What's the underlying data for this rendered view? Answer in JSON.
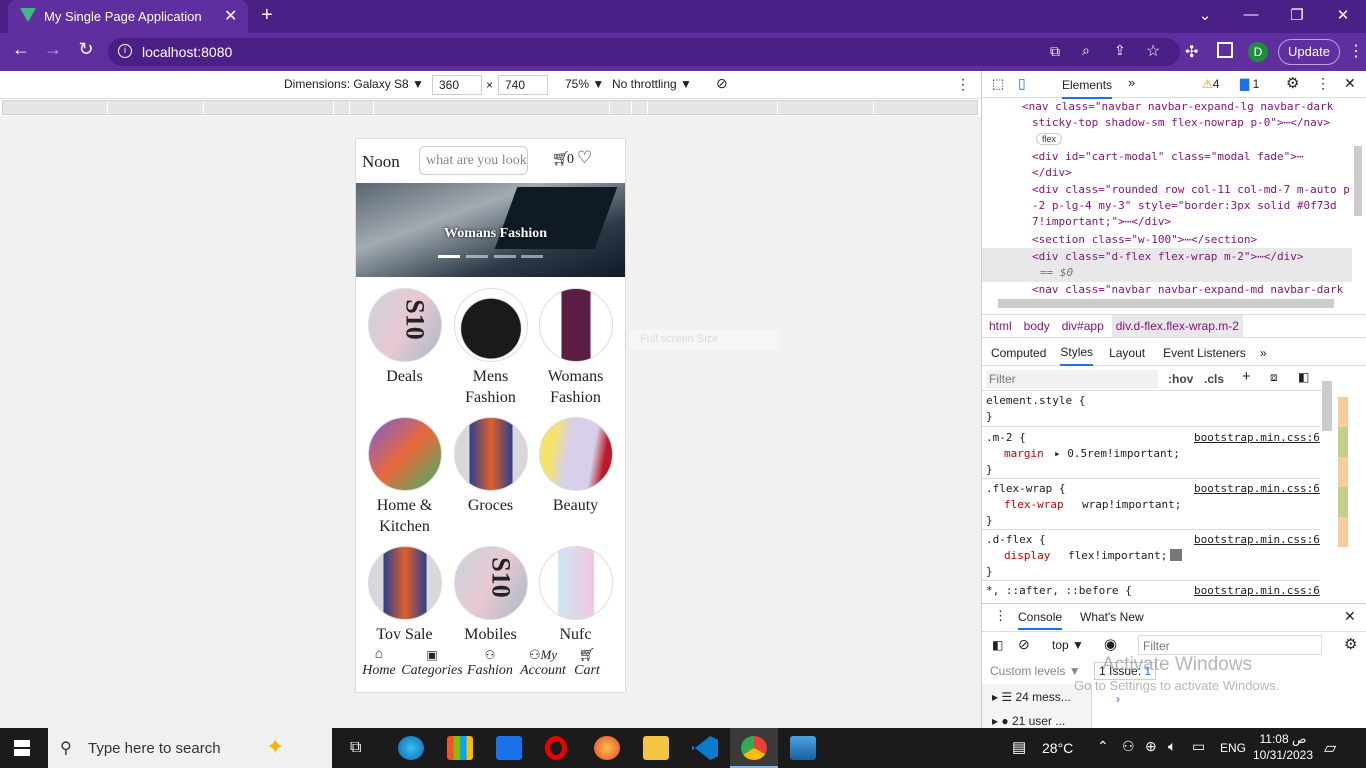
{
  "browser": {
    "tab_title": "My Single Page Application",
    "url": "localhost:8080",
    "update_label": "Update",
    "profile_initial": "D"
  },
  "device_toolbar": {
    "dimensions_label": "Dimensions: Galaxy S8",
    "width": "360",
    "height": "740",
    "zoom": "75%",
    "throttling": "No throttling",
    "ghost_text": "Full screen Size"
  },
  "app": {
    "brand": "Noon",
    "search_placeholder": "what are you looking for",
    "cart_count": "0",
    "banner_caption": "Womans Fashion",
    "categories": [
      {
        "line1": "Deals",
        "line2": ""
      },
      {
        "line1": "Mens",
        "line2": "Fashion"
      },
      {
        "line1": "Womans",
        "line2": "Fashion"
      },
      {
        "line1": "Home &",
        "line2": "Kitchen"
      },
      {
        "line1": "Groces",
        "line2": ""
      },
      {
        "line1": "Beauty",
        "line2": ""
      },
      {
        "line1": "Toy Sale",
        "line2": ""
      },
      {
        "line1": "Mobiles",
        "line2": ""
      },
      {
        "line1": "Nufc",
        "line2": ""
      }
    ],
    "bottom_nav": [
      "Home",
      "Categories",
      "Fashion",
      "Account",
      "Cart"
    ],
    "bottom_nav_my": "My"
  },
  "devtools": {
    "tab_elements": "Elements",
    "warnings": "4",
    "messages": "1",
    "dom_lines": [
      "<nav class=\"navbar navbar-expand-lg navbar-dark",
      "sticky-top shadow-sm flex-nowrap p-0\">⋯</nav>",
      "flex",
      "<div id=\"cart-modal\" class=\"modal fade\">⋯",
      "</div>",
      "<div class=\"rounded row col-11 col-md-7 m-auto p",
      "-2 p-lg-4 my-3\" style=\"border:3px  solid #0f73d",
      "7!important;\">⋯</div>",
      "<section class=\"w-100\">⋯</section>",
      "<div class=\"d-flex flex-wrap m-2\">⋯</div>",
      "== $0",
      "<nav class=\"navbar navbar-expand-md navbar-dark"
    ],
    "breadcrumb": [
      "html",
      "body",
      "div#app",
      "div.d-flex.flex-wrap.m-2"
    ],
    "subtabs": [
      "Computed",
      "Styles",
      "Layout",
      "Event Listeners"
    ],
    "filter_placeholder": "Filter",
    "hov": ":hov",
    "cls": ".cls",
    "rules": [
      {
        "selector": "element.style {",
        "prop": "",
        "value": "",
        "source": ""
      },
      {
        "selector": ".m-2 {",
        "prop": "margin",
        "value": "▸ 0.5rem!important;",
        "source": "bootstrap.min.css:6"
      },
      {
        "selector": ".flex-wrap {",
        "prop": "flex-wrap",
        "value": "wrap!important;",
        "source": "bootstrap.min.css:6"
      },
      {
        "selector": ".d-flex {",
        "prop": "display",
        "value": "flex!important;",
        "source": "bootstrap.min.css:6"
      },
      {
        "selector": "*, ::after, ::before {",
        "prop": "",
        "value": "",
        "source": "bootstrap.min.css:6"
      }
    ],
    "console_tab": "Console",
    "whats_new": "What's New",
    "context": "top",
    "console_filter": "Filter",
    "custom_levels": "Custom levels",
    "issues": "1 Issue:",
    "issues_count": "1",
    "messages_row": "24 mess...",
    "user_row": "21 user ...",
    "activate_title": "Activate Windows",
    "activate_sub": "Go to Settings to activate Windows."
  },
  "taskbar": {
    "search_placeholder": "Type here to search",
    "temperature": "28°C",
    "language": "ENG",
    "time": "11:08",
    "ampm": "ص",
    "date": "10/31/2023"
  }
}
